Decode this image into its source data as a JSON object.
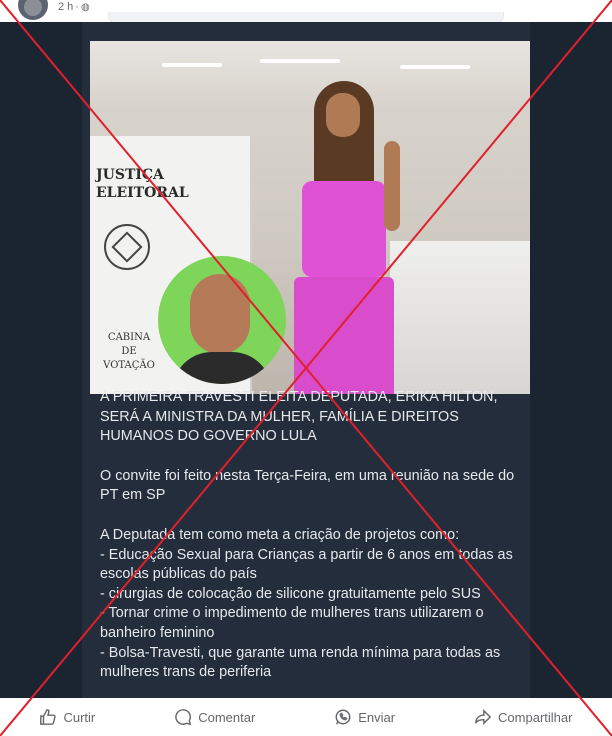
{
  "post": {
    "time": "2 h",
    "privacy_icon": "globe-icon",
    "image": {
      "booth_label": "JUSTIÇA ELEITORAL",
      "booth_sublabel": "CABINA DE VOTAÇÃO"
    },
    "caption": [
      "A PRIMEIRA TRAVESTI ELEITA DEPUTADA, ERIKA HILTON, SERÁ A MINISTRA DA MULHER, FAMÍLIA E DIREITOS HUMANOS DO GOVERNO LULA",
      "O convite foi feito nesta Terça-Feira, em uma reunião na sede do PT em SP",
      "A Deputada tem como meta a criação de projetos como:\n- Educação Sexual para Crianças a partir de 6 anos em todas as escolas públicas do país\n- cirurgias de colocação de silicone gratuitamente pelo SUS\n- Tornar crime o impedimento de mulheres trans utilizarem o banheiro feminino\n- Bolsa-Travesti, que garante uma renda mínima para todas as mulheres trans de periferia"
    ]
  },
  "actions": {
    "like": "Curtir",
    "comment": "Comentar",
    "send": "Enviar",
    "share": "Compartilhar"
  },
  "colors": {
    "post_bg": "#1b2431",
    "caption_text": "#e6e8eb",
    "cross_lines": "#e0202a",
    "action_text": "#65676b"
  }
}
